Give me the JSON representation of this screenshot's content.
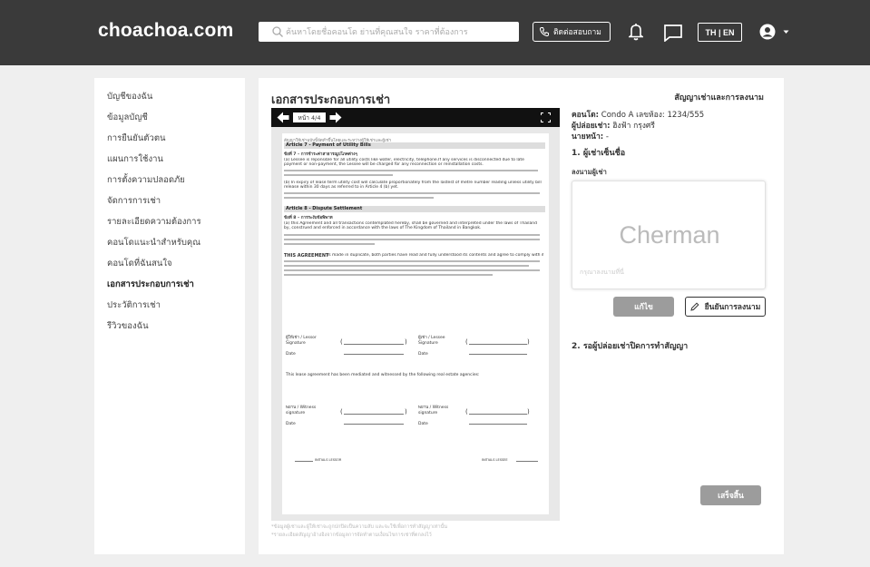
{
  "header": {
    "logo": "choachoa.com",
    "search_placeholder": "ค้นหาโดยชื่อคอนโด ย่านที่คุณสนใจ ราคาที่ต้องการ",
    "contact_label": "ติดต่อสอบถาม",
    "lang_label": "TH | EN"
  },
  "sidebar": {
    "items": [
      {
        "label": "บัญชีของฉัน",
        "active": false
      },
      {
        "label": "ข้อมูลบัญชี",
        "active": false
      },
      {
        "label": "การยืนยันตัวตน",
        "active": false
      },
      {
        "label": "แผนการใช้งาน",
        "active": false
      },
      {
        "label": "การตั้งความปลอดภัย",
        "active": false
      },
      {
        "label": "จัดการการเช่า",
        "active": false
      },
      {
        "label": "รายละเอียดความต้องการ",
        "active": false
      },
      {
        "label": "คอนโดแนะนำสำหรับคุณ",
        "active": false
      },
      {
        "label": "คอนโดที่ฉันสนใจ",
        "active": false
      },
      {
        "label": "เอกสารประกอบการเช่า",
        "active": true
      },
      {
        "label": "ประวัติการเช่า",
        "active": false
      },
      {
        "label": "รีวิวของฉัน",
        "active": false
      }
    ]
  },
  "main": {
    "title": "เอกสารประกอบการเช่า",
    "right_header": "สัญญาเช่าและการลงนาม",
    "viewer": {
      "page_label": "หน้า 4/4",
      "intro": "สัญญาให้เช่าฉบับนี้จัดทำขึ้นโดยและระหว่างผู้ให้เช่าและผู้เช่า",
      "article7_title": "Article 7 - Payment of Utility Bills",
      "article7_th": "ข้อที่ 7 – การชำระค่าสาธารณูปโภคต่างๆ",
      "article7_a": "(a) Lessee is reponsible for all utility costs like water, electricity, telephone.If any services is disconnected due to late payment or non-payment, the Lessee will be charged for any reconnection or reinstallation costs.",
      "article7_b": "(b) In expiry of lease term utility cost will calculate proportionately from the lastest of metre number reading unless utility bill release within 30 days as referred to in Article 4 (b) yet.",
      "article8_title": "Article 8 - Dispute Settlement",
      "article8_th": "ข้อที่ 8 – การระงับข้อพิพาท",
      "article8_a": "(a) this Agreement and all transactions contemplated hereby, shall be governed and interpreted under the laws of Thailand by, construed and enforced in accordance with the laws of The Kingdom of Thailand in Bangkok.",
      "agreement_bold": "THIS AGREEMENT",
      "agreement_text": "is made in duplicate, both parties have read and fully understood its contents and agree to comply with its terms and conditions.",
      "lessor_label": "ผู้ให้เช่า / Lessor Signature",
      "lessee_label": "ผู้เช่า / Lessee Signature",
      "date_label": "Date",
      "witness_note": "This lease agreement has been mediated and witnessed by the following real estate agencies:",
      "witness_label": "พยาน / Witness signature",
      "initials_left": "INITIALS LESSOR",
      "initials_right": "INITIALS LESSEE"
    },
    "footnotes": [
      "*ข้อมูลผู้เช่าและผู้ให้เช่าจะถูกปกปิดเป็นความลับ และจะใช้เพื่อการทำสัญญาเท่านั้น",
      "*รายละเอียดสัญญาอ้างอิงจากข้อมูลการจัดทำตามเงื่อนไขการเช่าที่ตกลงไว้"
    ],
    "condo_label": "คอนโด:",
    "condo_value": "Condo A เลขห้อง: 1234/555",
    "lessor_label": "ผู้ปล่อยเช่า:",
    "lessor_value": "ฮิงฟ้า กรุงศรี",
    "agent_label": "นายหน้า:",
    "agent_value": "-",
    "step1": "1. ผู้เช่าเซ็นชื่อ",
    "signature_label": "ลงนามผู้เช่า",
    "signature_value": "Cherman",
    "signature_placeholder": "กรุณาลงนามที่นี่",
    "edit_button": "แก้ไข",
    "confirm_button": "ยืนยันการลงนาม",
    "step2": "2. รอผู้ปล่อยเช่าปิดการทำสัญญา",
    "done_button": "เสร็จสิ้น"
  },
  "colors": {
    "header_bg": "#3a3a3a",
    "button_gray": "#9c9c9c",
    "page_bg": "#efefef"
  }
}
